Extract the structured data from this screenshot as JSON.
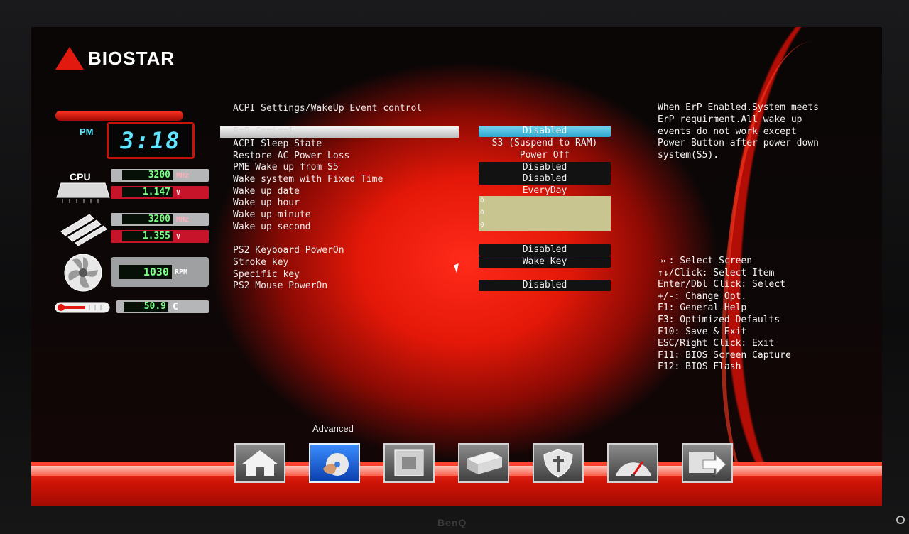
{
  "brand": {
    "logo_text": "BIOSTAR",
    "monitor_brand": "BenQ"
  },
  "clock": {
    "ampm": "PM",
    "time": "3:18"
  },
  "hw": {
    "cpu_label": "CPU",
    "cpu_freq": "3200",
    "cpu_freq_unit": "MHz",
    "cpu_volt": "1.147",
    "cpu_volt_unit": "V",
    "mem_freq": "3200",
    "mem_freq_unit": "MHz",
    "mem_volt": "1.355",
    "mem_volt_unit": "V",
    "fan_rpm": "1030",
    "fan_unit": "RPM",
    "temp": "50.9",
    "temp_unit": "C"
  },
  "page": {
    "title": "ACPI Settings/WakeUp Event control"
  },
  "settings": [
    {
      "label": "ErP Control",
      "value": "Disabled"
    },
    {
      "label": "ACPI Sleep State",
      "value": "S3 (Suspend to RAM)"
    },
    {
      "label": "Restore AC Power Loss",
      "value": "Power Off"
    },
    {
      "label": "PME Wake up from S5",
      "value": "Disabled"
    },
    {
      "label": "Wake system with Fixed Time",
      "value": "Disabled"
    },
    {
      "label": "Wake up date",
      "value": "EveryDay"
    },
    {
      "label": "Wake up hour",
      "value": "0"
    },
    {
      "label": "Wake up minute",
      "value": "0"
    },
    {
      "label": "Wake up second",
      "value": "0"
    },
    {
      "label": "PS2 Keyboard PowerOn",
      "value": "Disabled"
    },
    {
      "label": "Stroke key",
      "value": "Wake Key"
    },
    {
      "label": "Specific key",
      "value": ""
    },
    {
      "label": "PS2 Mouse PowerOn",
      "value": "Disabled"
    }
  ],
  "help": [
    "When ErP Enabled.System meets",
    "ErP requirment.All wake up",
    "events do not work except",
    "Power Button after power down",
    "system(S5)."
  ],
  "keys": [
    "→←: Select Screen",
    "↑↓/Click: Select Item",
    "Enter/Dbl Click: Select",
    "+/-: Change Opt.",
    "F1: General Help",
    "F3: Optimized Defaults",
    "F10: Save & Exit",
    "ESC/Right Click: Exit",
    "F11: BIOS Screen Capture",
    "F12: BIOS Flash"
  ],
  "nav": {
    "active_label": "Advanced",
    "items": [
      "home-icon",
      "advanced-icon",
      "chipset-icon",
      "storage-icon",
      "security-icon",
      "overclock-icon",
      "exit-icon"
    ]
  },
  "colors": {
    "accent": "#e2190f",
    "selected_value": "#3fb3d9",
    "digital": "#7bff86",
    "clock": "#61e6ff"
  }
}
